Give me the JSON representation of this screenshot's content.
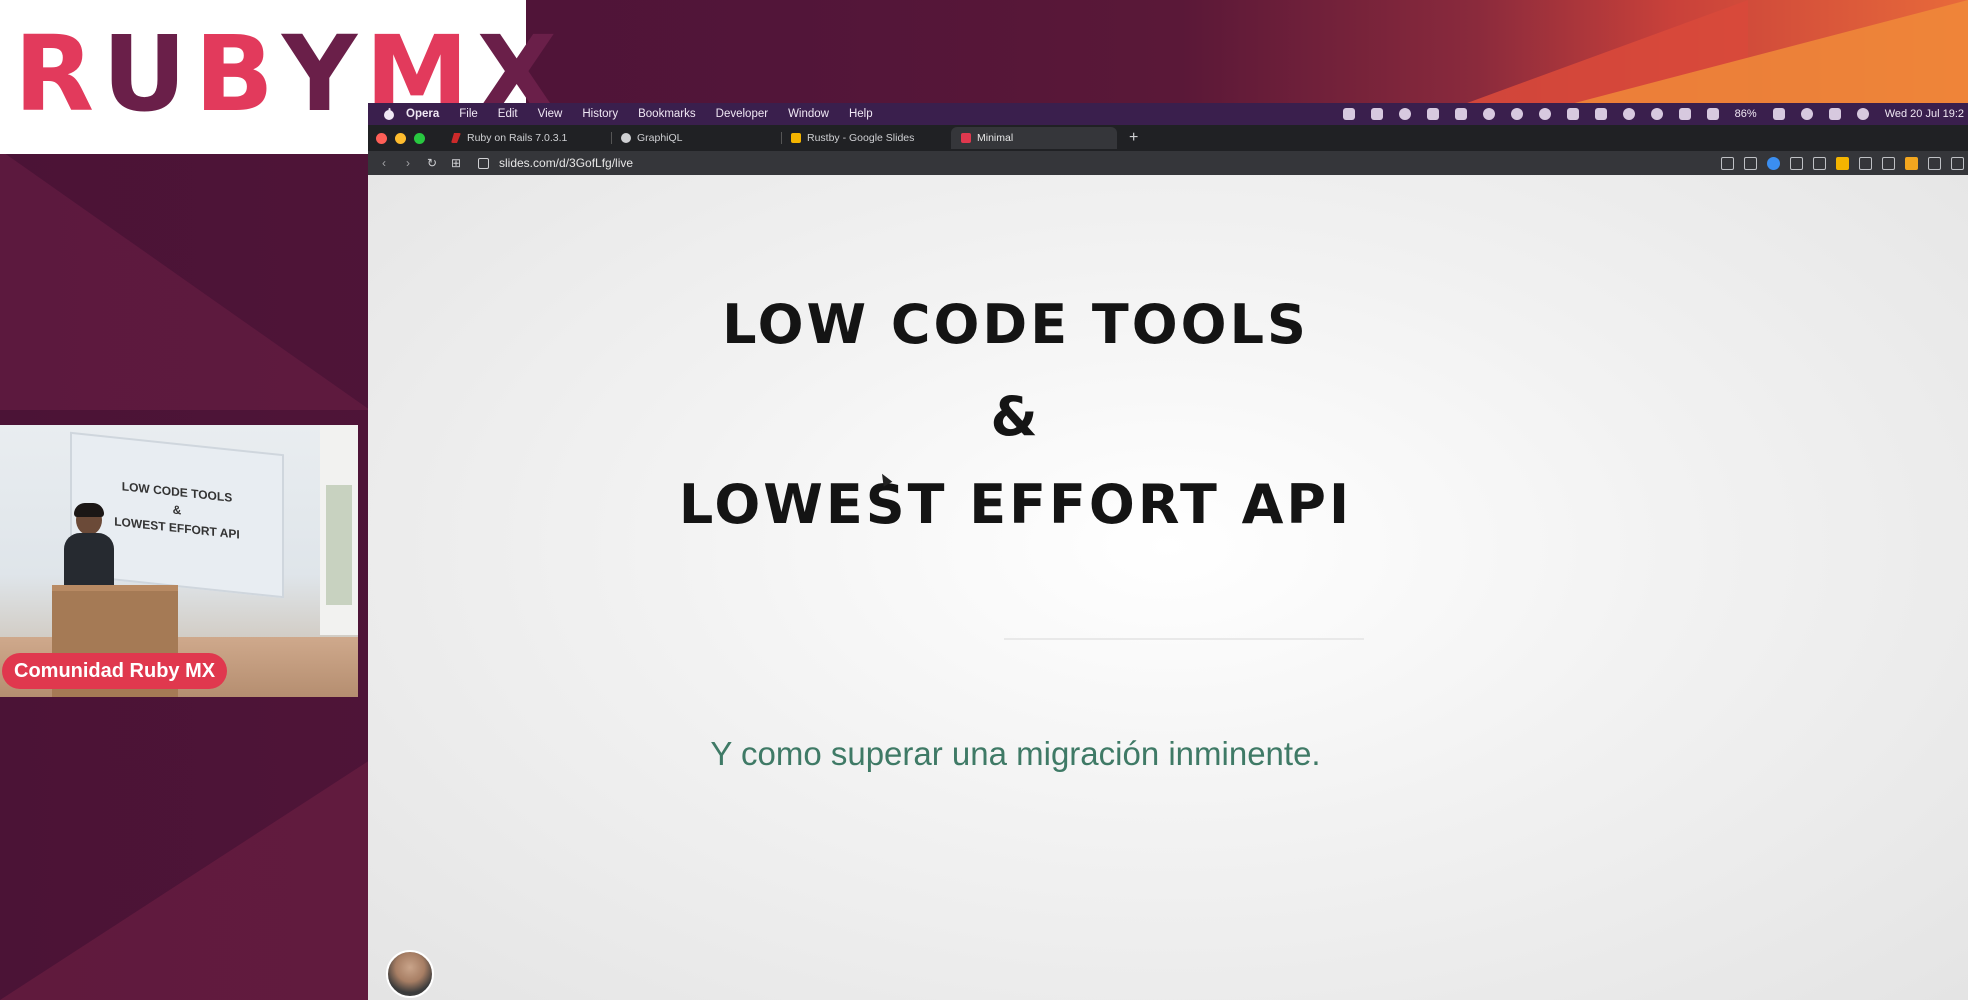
{
  "logo": {
    "letters": [
      "R",
      "U",
      "B",
      "Y",
      "M",
      "X"
    ]
  },
  "webcam": {
    "label": "Comunidad Ruby MX",
    "screen_lines": [
      "LOW CODE TOOLS",
      "&",
      "LOWEST EFFORT API"
    ]
  },
  "menubar": {
    "items": [
      "Opera",
      "File",
      "Edit",
      "View",
      "History",
      "Bookmarks",
      "Developer",
      "Window",
      "Help"
    ],
    "battery": "86%",
    "datetime": "Wed 20 Jul  19:2"
  },
  "tabs": [
    {
      "label": "Ruby on Rails 7.0.3.1",
      "icon": "rails-icon",
      "active": false
    },
    {
      "label": "GraphiQL",
      "icon": "graphql-icon",
      "active": false
    },
    {
      "label": "Rustby - Google Slides",
      "icon": "slides-icon",
      "active": false
    },
    {
      "label": "Minimal",
      "icon": "minimal-icon",
      "active": true
    }
  ],
  "addressbar": {
    "url": "slides.com/d/3GofLfg/live"
  },
  "slide": {
    "title_line1": "LOW CODE TOOLS",
    "title_line2": "&",
    "title_line3": "LOWEST EFFORT API",
    "subtitle": "Y como superar una migración inminente."
  },
  "colors": {
    "brand_pink": "#e23a5c",
    "brand_purple": "#6a1f49",
    "label_red": "#e0384e",
    "subtitle_green": "#3f7a66"
  }
}
